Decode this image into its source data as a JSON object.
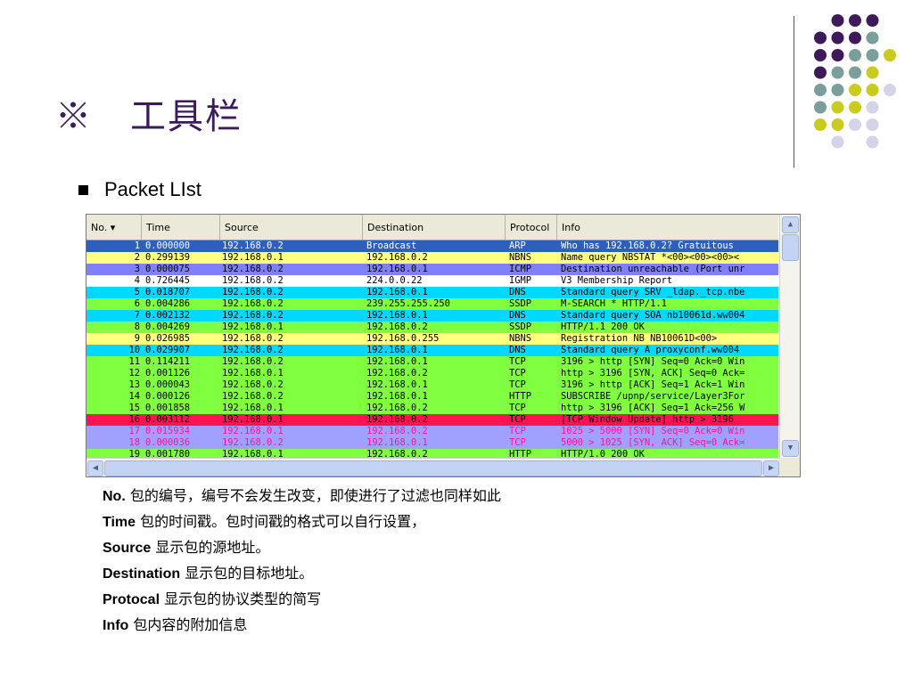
{
  "slide": {
    "title": "※　工具栏",
    "subtitle": "Packet LIst"
  },
  "packet_list": {
    "columns": [
      "No. ▾",
      "Time",
      "Source",
      "Destination",
      "Protocol",
      "Info"
    ],
    "rows": [
      {
        "no": "1",
        "time": "0.000000",
        "source": "192.168.0.2",
        "destination": "Broadcast",
        "protocol": "ARP",
        "info": "Who has 192.168.0.2?  Gratuitous",
        "bg": "#2f5fbd",
        "fg": "#ffffff"
      },
      {
        "no": "2",
        "time": "0.299139",
        "source": "192.168.0.1",
        "destination": "192.168.0.2",
        "protocol": "NBNS",
        "info": "Name query NBSTAT *<00><00><00><",
        "bg": "#ffff80",
        "fg": "#000000"
      },
      {
        "no": "3",
        "time": "0.000075",
        "source": "192.168.0.2",
        "destination": "192.168.0.1",
        "protocol": "ICMP",
        "info": "Destination unreachable (Port unr",
        "bg": "#8080ff",
        "fg": "#000000"
      },
      {
        "no": "4",
        "time": "0.726445",
        "source": "192.168.0.2",
        "destination": "224.0.0.22",
        "protocol": "IGMP",
        "info": "V3 Membership Report",
        "bg": "#ffffff",
        "fg": "#000000"
      },
      {
        "no": "5",
        "time": "0.018707",
        "source": "192.168.0.2",
        "destination": "192.168.0.1",
        "protocol": "DNS",
        "info": "Standard query SRV _ldap._tcp.nbe",
        "bg": "#00d8ff",
        "fg": "#000000"
      },
      {
        "no": "6",
        "time": "0.004286",
        "source": "192.168.0.2",
        "destination": "239.255.255.250",
        "protocol": "SSDP",
        "info": "M-SEARCH * HTTP/1.1",
        "bg": "#80ff40",
        "fg": "#000000"
      },
      {
        "no": "7",
        "time": "0.002132",
        "source": "192.168.0.2",
        "destination": "192.168.0.1",
        "protocol": "DNS",
        "info": "Standard query SOA nb10061d.ww004",
        "bg": "#00d8ff",
        "fg": "#000000"
      },
      {
        "no": "8",
        "time": "0.004269",
        "source": "192.168.0.1",
        "destination": "192.168.0.2",
        "protocol": "SSDP",
        "info": "HTTP/1.1 200 OK",
        "bg": "#80ff40",
        "fg": "#000000"
      },
      {
        "no": "9",
        "time": "0.026985",
        "source": "192.168.0.2",
        "destination": "192.168.0.255",
        "protocol": "NBNS",
        "info": "Registration NB NB10061D<00>",
        "bg": "#ffff80",
        "fg": "#000000"
      },
      {
        "no": "10",
        "time": "0.029907",
        "source": "192.168.0.2",
        "destination": "192.168.0.1",
        "protocol": "DNS",
        "info": "Standard query A proxyconf.ww004",
        "bg": "#00d8ff",
        "fg": "#000000"
      },
      {
        "no": "11",
        "time": "0.114211",
        "source": "192.168.0.2",
        "destination": "192.168.0.1",
        "protocol": "TCP",
        "info": "3196 > http [SYN] Seq=0 Ack=0 Win",
        "bg": "#80ff40",
        "fg": "#000000"
      },
      {
        "no": "12",
        "time": "0.001126",
        "source": "192.168.0.1",
        "destination": "192.168.0.2",
        "protocol": "TCP",
        "info": "http > 3196 [SYN, ACK] Seq=0 Ack=",
        "bg": "#80ff40",
        "fg": "#000000"
      },
      {
        "no": "13",
        "time": "0.000043",
        "source": "192.168.0.2",
        "destination": "192.168.0.1",
        "protocol": "TCP",
        "info": "3196 > http [ACK] Seq=1 Ack=1 Win",
        "bg": "#80ff40",
        "fg": "#000000"
      },
      {
        "no": "14",
        "time": "0.000126",
        "source": "192.168.0.2",
        "destination": "192.168.0.1",
        "protocol": "HTTP",
        "info": "SUBSCRIBE /upnp/service/Layer3For",
        "bg": "#80ff40",
        "fg": "#000000"
      },
      {
        "no": "15",
        "time": "0.001858",
        "source": "192.168.0.1",
        "destination": "192.168.0.2",
        "protocol": "TCP",
        "info": "http > 3196 [ACK] Seq=1 Ack=256 W",
        "bg": "#80ff40",
        "fg": "#000000"
      },
      {
        "no": "16",
        "time": "0.003112",
        "source": "192.168.0.1",
        "destination": "192.168.0.2",
        "protocol": "TCP",
        "info": "[TCP Window Update] http > 3196",
        "bg": "#ff1450",
        "fg": "#000000"
      },
      {
        "no": "17",
        "time": "0.015934",
        "source": "192.168.0.1",
        "destination": "192.168.0.2",
        "protocol": "TCP",
        "info": "1025 > 5000 [SYN] Seq=0 Ack=0 Win",
        "bg": "#a0a0ff",
        "fg": "#ff1493"
      },
      {
        "no": "18",
        "time": "0.000036",
        "source": "192.168.0.2",
        "destination": "192.168.0.1",
        "protocol": "TCP",
        "info": "5000 > 1025 [SYN, ACK] Seq=0 Ack=",
        "bg": "#a0a0ff",
        "fg": "#ff1493"
      },
      {
        "no": "19",
        "time": "0.001780",
        "source": "192.168.0.1",
        "destination": "192.168.0.2",
        "protocol": "HTTP",
        "info": "HTTP/1.0 200 OK",
        "bg": "#80ff40",
        "fg": "#000000"
      }
    ]
  },
  "scroll": {
    "up_icon": "▲",
    "down_icon": "▼",
    "left_icon": "◀",
    "right_icon": "▶"
  },
  "descriptions": [
    {
      "term": "No.",
      "text": " 包的编号，编号不会发生改变，即使进行了过滤也同样如此"
    },
    {
      "term": "Time",
      "text": " 包的时间戳。包时间戳的格式可以自行设置，"
    },
    {
      "term": "Source",
      "text": " 显示包的源地址。"
    },
    {
      "term": "Destination",
      "text": " 显示包的目标地址。"
    },
    {
      "term": "Protocal",
      "text": " 显示包的协议类型的简写"
    },
    {
      "term": "Info",
      "text": " 包内容的附加信息"
    }
  ],
  "colors": {
    "title": "#3b1a5e",
    "dot_purple": "#3f1a5b",
    "dot_teal": "#7a9e9a",
    "dot_yellow": "#c9cc1e",
    "dot_lavender": "#d3d3ea"
  }
}
